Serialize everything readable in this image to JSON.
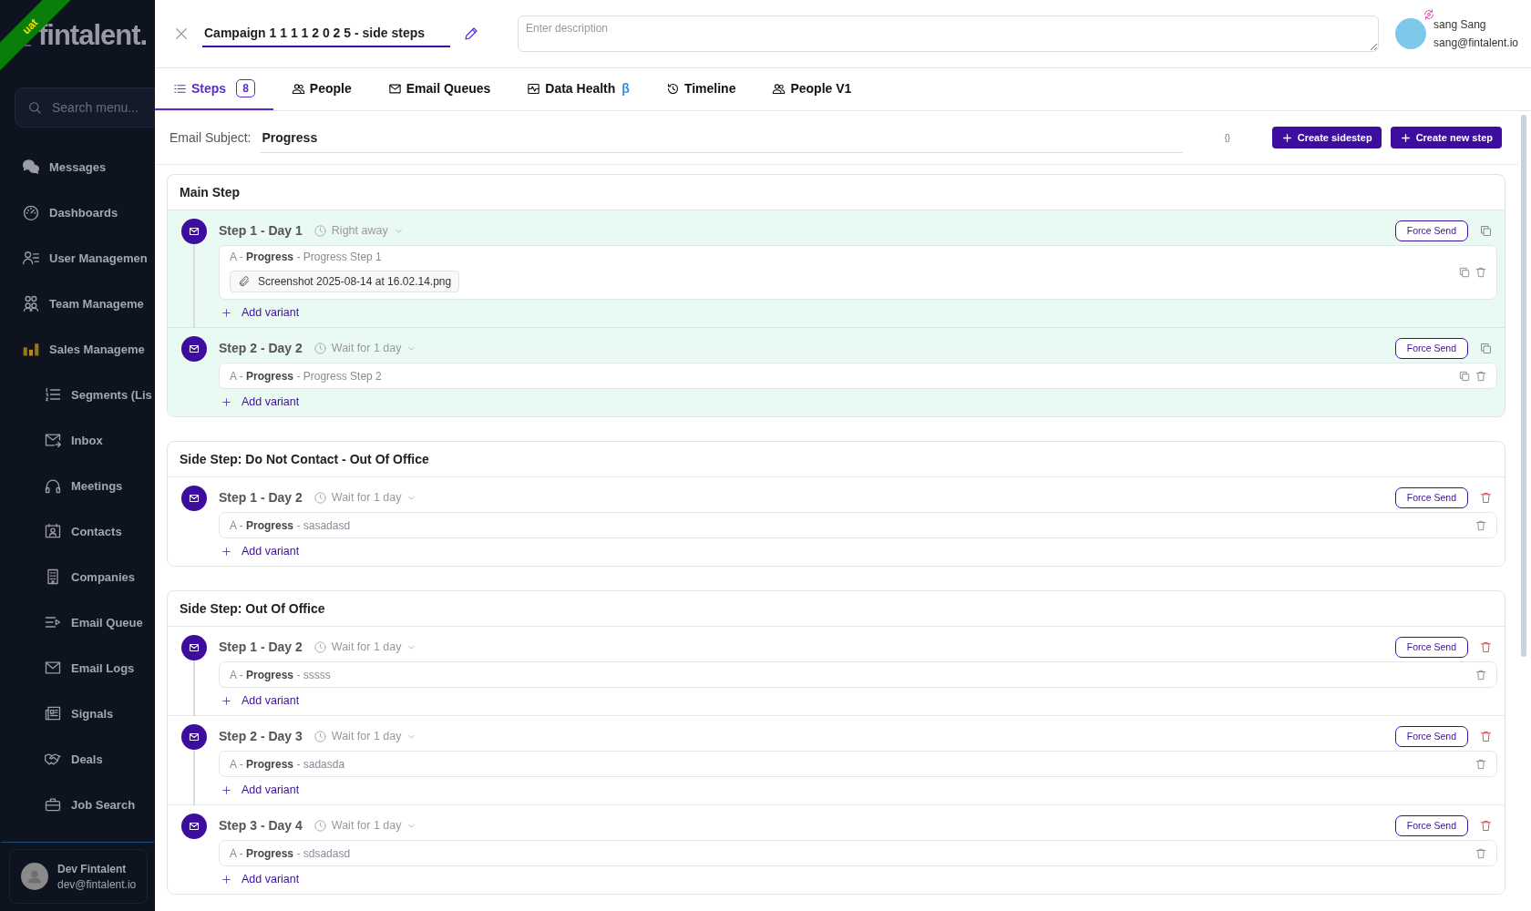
{
  "sidebar": {
    "logo": "fintalent.",
    "env_ribbon": "uat",
    "search": {
      "placeholder": "Search menu..."
    },
    "items": [
      {
        "label": "Messages"
      },
      {
        "label": "Dashboards"
      },
      {
        "label": "User Managemen"
      },
      {
        "label": "Team Manageme"
      },
      {
        "label": "Sales Manageme",
        "children": [
          {
            "label": "Segments (Lis"
          },
          {
            "label": "Inbox"
          },
          {
            "label": "Meetings"
          },
          {
            "label": "Contacts"
          },
          {
            "label": "Companies"
          },
          {
            "label": "Email Queue"
          },
          {
            "label": "Email Logs"
          },
          {
            "label": "Signals"
          },
          {
            "label": "Deals"
          },
          {
            "label": "Job Search"
          }
        ]
      }
    ],
    "user": {
      "name": "Dev Fintalent",
      "email": "dev@fintalent.io"
    }
  },
  "header": {
    "campaign_name": "Campaign 1 1 1 1 2 0 2 5 - side steps",
    "description": {
      "placeholder": "Enter description"
    },
    "user": {
      "name": "sang Sang",
      "email": "sang@fintalent.io"
    }
  },
  "tabs": [
    {
      "label": "Steps",
      "count": "8",
      "selected": true
    },
    {
      "label": "People",
      "selected": false
    },
    {
      "label": "Email Queues",
      "selected": false
    },
    {
      "label": "Data Health",
      "suffix": "β",
      "selected": false
    },
    {
      "label": "Timeline",
      "selected": false
    },
    {
      "label": "People V1",
      "selected": false
    }
  ],
  "subject": {
    "label": "Email Subject:",
    "value": "Progress",
    "braces": "{}"
  },
  "actions": [
    "Create sidestep",
    "Create new step"
  ],
  "sections": [
    {
      "title": "Main Step",
      "highlighted": true,
      "steps": [
        {
          "title": "Step 1 - Day 1",
          "delay": "Right away",
          "force_send": "Force Send",
          "kind": "main",
          "variants": [
            {
              "text": "A - **Progress** - Progress Step 1",
              "copyable": true,
              "attachments": [
                "Screenshot 2025-08-14 at 16.02.14.png"
              ]
            }
          ],
          "add_variant": "Add variant"
        },
        {
          "title": "Step 2 - Day 2",
          "delay": "Wait for 1 day",
          "force_send": "Force Send",
          "kind": "main",
          "variants": [
            {
              "text": "A - **Progress** - Progress Step 2",
              "copyable": true
            }
          ],
          "add_variant": "Add variant"
        }
      ]
    },
    {
      "title": "Side Step: Do Not Contact - Out Of Office",
      "highlighted": false,
      "steps": [
        {
          "title": "Step 1 - Day 2",
          "delay": "Wait for 1 day",
          "force_send": "Force Send",
          "kind": "side",
          "variants": [
            {
              "text": "A - **Progress** - sasadasd",
              "copyable": false
            }
          ],
          "add_variant": "Add variant"
        }
      ]
    },
    {
      "title": "Side Step: Out Of Office",
      "highlighted": false,
      "steps": [
        {
          "title": "Step 1 - Day 2",
          "delay": "Wait for 1 day",
          "force_send": "Force Send",
          "kind": "side",
          "variants": [
            {
              "text": "A - **Progress** - sssss",
              "copyable": false
            }
          ],
          "add_variant": "Add variant"
        },
        {
          "title": "Step 2 - Day 3",
          "delay": "Wait for 1 day",
          "force_send": "Force Send",
          "kind": "side",
          "variants": [
            {
              "text": "A - **Progress** - sadasda",
              "copyable": false
            }
          ],
          "add_variant": "Add variant"
        },
        {
          "title": "Step 3 - Day 4",
          "delay": "Wait for 1 day",
          "force_send": "Force Send",
          "kind": "side",
          "variants": [
            {
              "text": "A - **Progress** - sdsadasd",
              "copyable": false
            }
          ],
          "add_variant": "Add variant"
        }
      ]
    }
  ]
}
